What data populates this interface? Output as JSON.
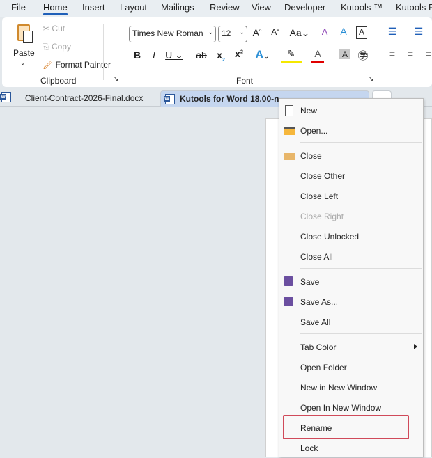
{
  "menubar": [
    "File",
    "Home",
    "Insert",
    "Layout",
    "Mailings",
    "Review",
    "View",
    "Developer",
    "Kutools ™",
    "Kutools Plus"
  ],
  "clipboard": {
    "paste": "Paste",
    "cut": "Cut",
    "copy": "Copy",
    "format_painter": "Format Painter",
    "group": "Clipboard"
  },
  "font": {
    "name": "Times New Roman",
    "size": "12",
    "group": "Font"
  },
  "tabs": [
    {
      "label": "Client-Contract-2026-Final.docx"
    },
    {
      "label": "Kutools for Word 18.00-n"
    }
  ],
  "context_menu": {
    "items": [
      {
        "label": "New",
        "icon": "new-document-icon"
      },
      {
        "label": "Open...",
        "icon": "folder-open-icon"
      },
      {
        "label": "Close",
        "icon": "folder-close-icon"
      },
      {
        "label": "Close Other"
      },
      {
        "label": "Close Left"
      },
      {
        "label": "Close Right",
        "disabled": true
      },
      {
        "label": "Close Unlocked"
      },
      {
        "label": "Close All"
      },
      {
        "label": "Save",
        "icon": "save-icon"
      },
      {
        "label": "Save As...",
        "icon": "save-as-icon"
      },
      {
        "label": "Save All"
      },
      {
        "label": "Tab Color",
        "submenu": true
      },
      {
        "label": "Open Folder"
      },
      {
        "label": "New in New Window"
      },
      {
        "label": "Open In New Window"
      },
      {
        "label": "Rename",
        "highlighted": true
      },
      {
        "label": "Lock"
      }
    ]
  },
  "colors": {
    "accent": "#1f5fb8",
    "highlight_box": "#d04a5a",
    "active_tab": "#c5d6ef"
  }
}
